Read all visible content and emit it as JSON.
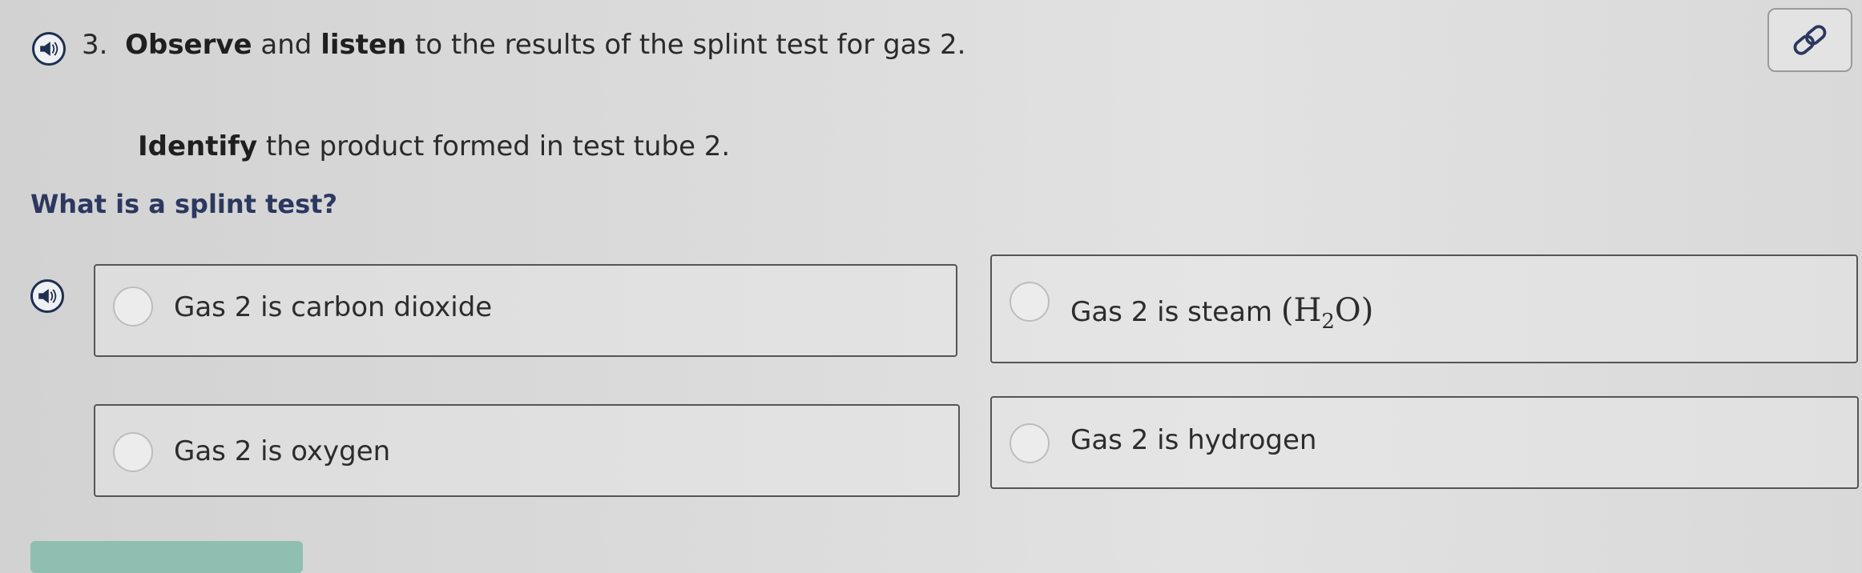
{
  "question": {
    "number": "3.",
    "observe_bold": "Observe",
    "and_word": " and ",
    "listen_bold": "listen",
    "rest": " to the results of the splint test for gas 2.",
    "identify_bold": "Identify",
    "identify_rest": " the product formed in test tube 2."
  },
  "help_link": "What is a splint test?",
  "options": [
    {
      "label": "Gas 2 is carbon dioxide"
    },
    {
      "label": "Gas 2 is steam",
      "formula_open": "(",
      "formula_main": "H",
      "formula_sub": "2",
      "formula_tail": "O",
      "formula_close": ")"
    },
    {
      "label": "Gas 2 is oxygen"
    },
    {
      "label": "Gas 2 is hydrogen"
    }
  ],
  "icons": {
    "speaker": "speaker-icon",
    "link": "link-icon"
  },
  "colors": {
    "accent": "#2b3860",
    "bottom_button": "#8fbfb0"
  }
}
